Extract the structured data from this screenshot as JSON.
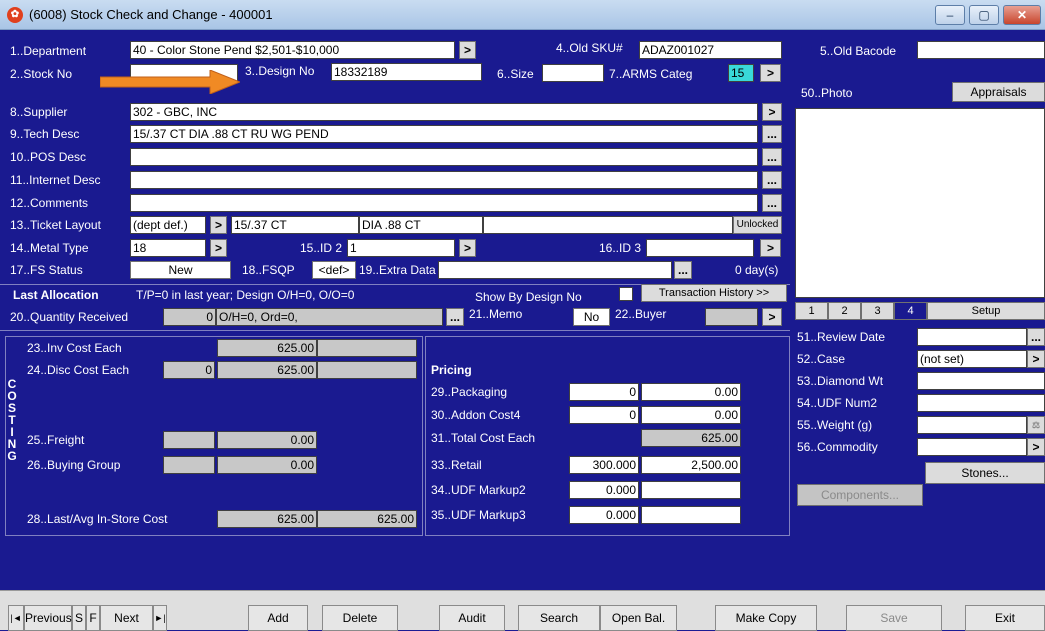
{
  "window": {
    "title": "(6008) Stock Check and Change - 400001",
    "minimize": "–",
    "maximize": "▢",
    "close": "✕"
  },
  "fields": {
    "department": {
      "label": "1..Department",
      "value": "40 - Color Stone Pend $2,501-$10,000"
    },
    "old_sku": {
      "label": "4..Old SKU#",
      "value": "ADAZ001027"
    },
    "old_barcode": {
      "label": "5..Old Bacode",
      "value": ""
    },
    "stock_no": {
      "label": "2..Stock No",
      "value": ""
    },
    "design_no": {
      "label": "3..Design No",
      "value": "18332189"
    },
    "size": {
      "label": "6..Size",
      "value": ""
    },
    "arms_categ": {
      "label": "7..ARMS Categ",
      "value": "15"
    },
    "supplier": {
      "label": "8..Supplier",
      "value": "302 - GBC, INC"
    },
    "tech_desc": {
      "label": "9..Tech Desc",
      "value": "15/.37 CT DIA .88 CT RU WG PEND"
    },
    "pos_desc": {
      "label": "10..POS Desc",
      "value": ""
    },
    "internet_desc": {
      "label": "11..Internet Desc",
      "value": ""
    },
    "comments": {
      "label": "12..Comments",
      "value": ""
    },
    "ticket_layout": {
      "label": "13..Ticket Layout",
      "value": "(dept def.)",
      "line1": "15/.37 CT",
      "line2": "DIA .88 CT",
      "lock": "Unlocked"
    },
    "metal_type": {
      "label": "14..Metal Type",
      "value": "18"
    },
    "id2": {
      "label": "15..ID 2",
      "value": "1"
    },
    "id3": {
      "label": "16..ID 3",
      "value": ""
    },
    "fs_status": {
      "label": "17..FS Status",
      "value": "New"
    },
    "fsqp": {
      "label": "18..FSQP",
      "value": "<def>"
    },
    "extra_data": {
      "label": "19..Extra Data",
      "value": "",
      "days": "0 day(s)"
    }
  },
  "photo": {
    "label": "50..Photo",
    "appraisals": "Appraisals"
  },
  "allocation": {
    "title": "Last Allocation",
    "summary": "T/P=0 in last year; Design O/H=0, O/O=0",
    "show_by_design": "Show By Design No",
    "history_button": "Transaction History >>",
    "qty_label": "20..Quantity Received",
    "qty_value": "0",
    "qty_info": "O/H=0, Ord=0,",
    "memo_label": "21..Memo",
    "memo_value": "No",
    "buyer_label": "22..Buyer",
    "buyer_value": ""
  },
  "tabs": [
    "1",
    "2",
    "3",
    "4",
    "Setup"
  ],
  "right": {
    "review_date": {
      "label": "51..Review Date",
      "value": ""
    },
    "case": {
      "label": "52..Case",
      "value": "(not set)"
    },
    "diamond_wt": {
      "label": "53..Diamond Wt",
      "value": ""
    },
    "udf_num2": {
      "label": "54..UDF Num2",
      "value": ""
    },
    "weight": {
      "label": "55..Weight (g)",
      "value": ""
    },
    "commodity": {
      "label": "56..Commodity",
      "value": ""
    },
    "stones": "Stones...",
    "components": "Components..."
  },
  "costing": {
    "vertical": [
      "C",
      "O",
      "S",
      "T",
      "I",
      "N",
      "G"
    ],
    "inv_cost": {
      "label": "23..Inv Cost Each",
      "value": "625.00"
    },
    "disc_cost": {
      "label": "24..Disc Cost Each",
      "pct": "0",
      "value": "625.00"
    },
    "freight": {
      "label": "25..Freight",
      "value": "0.00"
    },
    "buying_group": {
      "label": "26..Buying Group",
      "value": "0.00"
    },
    "last_avg": {
      "label": "28..Last/Avg In-Store Cost",
      "last": "625.00",
      "avg": "625.00"
    }
  },
  "pricing": {
    "title": "Pricing",
    "packaging": {
      "label": "29..Packaging",
      "qty": "0",
      "value": "0.00"
    },
    "addon": {
      "label": "30..Addon Cost4",
      "qty": "0",
      "value": "0.00"
    },
    "total_cost": {
      "label": "31..Total Cost Each",
      "value": "625.00"
    },
    "retail": {
      "label": "33..Retail",
      "markup": "300.000",
      "value": "2,500.00"
    },
    "udf_markup2": {
      "label": "34..UDF Markup2",
      "value": "0.000"
    },
    "udf_markup3": {
      "label": "35..UDF Markup3",
      "value": "0.000"
    }
  },
  "nav": {
    "first": "|◄",
    "previous": "Previous",
    "s": "S",
    "f": "F",
    "next": "Next",
    "last": "►|",
    "add": "Add",
    "delete": "Delete",
    "audit": "Audit",
    "search": "Search",
    "open_bal": "Open Bal.",
    "make_copy": "Make Copy",
    "save": "Save",
    "exit": "Exit"
  },
  "colors": {
    "background": "#1a1a90",
    "arrow": "#f08a24",
    "highlight": "#39d9d9"
  }
}
